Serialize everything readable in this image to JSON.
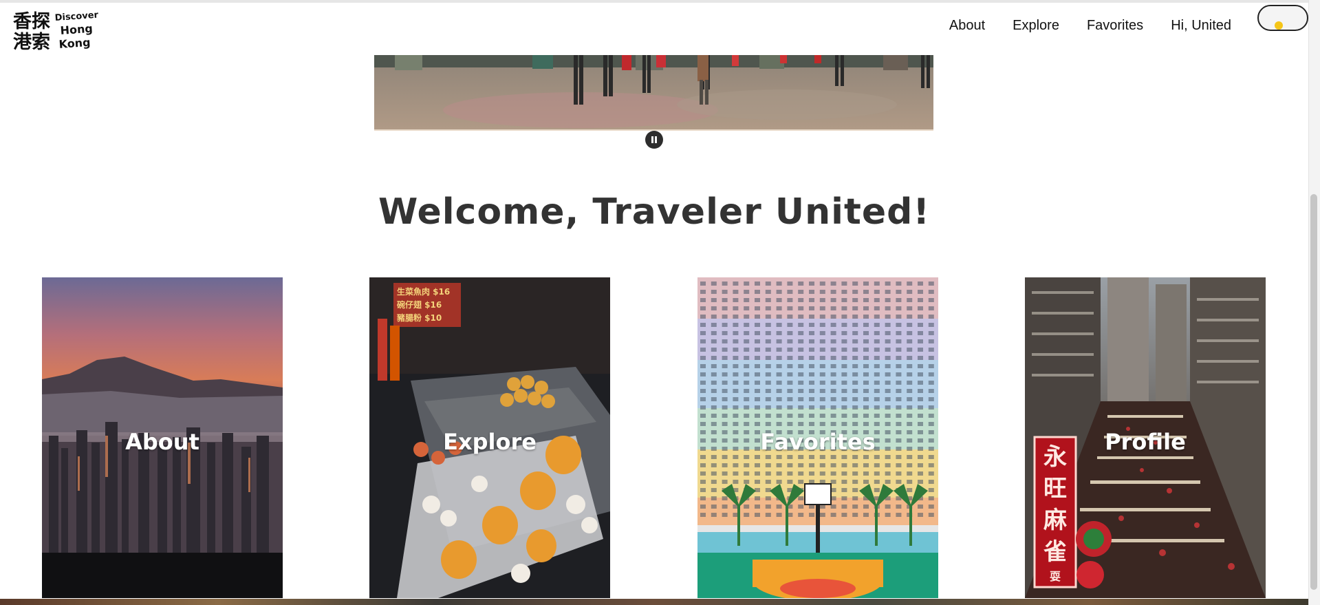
{
  "header": {
    "logo": {
      "chinese_top": "香探",
      "chinese_bottom": "港索",
      "english_top": "Discover",
      "english_mid": "Hong",
      "english_bottom": "Kong"
    },
    "nav": [
      "About",
      "Explore",
      "Favorites",
      "Hi, United"
    ],
    "theme_toggle": {
      "state": "light",
      "knob_color": "#f5c518"
    }
  },
  "carousel": {
    "control_icon": "pause-icon"
  },
  "welcome": {
    "title": "Welcome, Traveler United!"
  },
  "cards": [
    {
      "label": "About"
    },
    {
      "label": "Explore"
    },
    {
      "label": "Favorites"
    },
    {
      "label": "Profile"
    }
  ],
  "explore_card": {
    "stall_sign": [
      "生菜魚肉 $16",
      "碗仔翅  $16",
      "豬腸粉 $10"
    ]
  },
  "profile_card": {
    "neon_sign": [
      "永",
      "旺",
      "麻",
      "雀"
    ],
    "neon_sign_small": "耍"
  },
  "colors": {
    "text": "#111111",
    "heading": "#333333",
    "card_label": "#ffffff"
  }
}
